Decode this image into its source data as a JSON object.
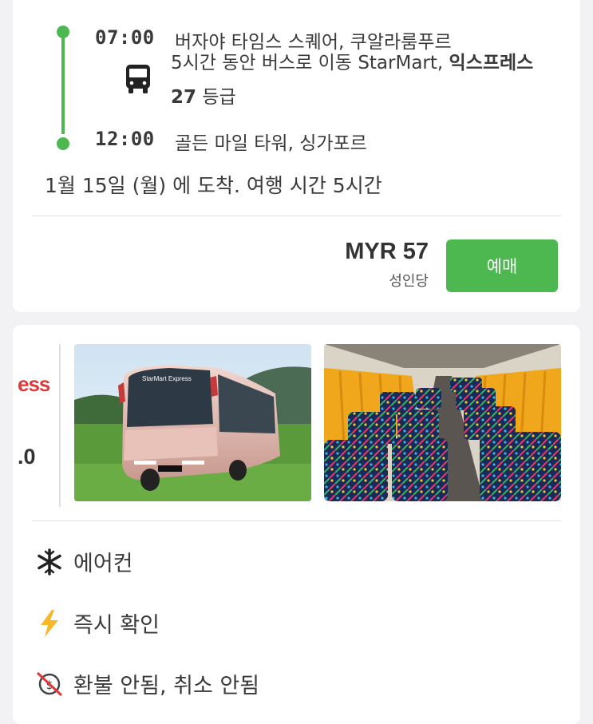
{
  "trip": {
    "depart_time": "07:00",
    "depart_place": "버자야 타임스 스퀘어, 쿠알라룸푸르",
    "description_plain": "5시간 동안 버스로 이동 StarMart, ",
    "description_bold": "익스프레스 27",
    "description_tail": " 등급",
    "arrive_time": "12:00",
    "arrive_place": "골든 마일 타워, 싱가포르",
    "arrival_note": "1월 15일 (월) 에 도착. 여행 시간 5시간",
    "price": "MYR 57",
    "price_label": "성인당",
    "book_label": "예매",
    "accent_color": "#4cb84f"
  },
  "operator": {
    "logo_text": "ess",
    "rating": ".0",
    "photos": [
      "bus-exterior",
      "bus-interior"
    ],
    "features": [
      {
        "icon": "snowflake-icon",
        "label": "에어컨"
      },
      {
        "icon": "lightning-icon",
        "label": "즉시 확인"
      },
      {
        "icon": "no-refund-icon",
        "label": "환불 안됨, 취소 안됨"
      }
    ]
  }
}
